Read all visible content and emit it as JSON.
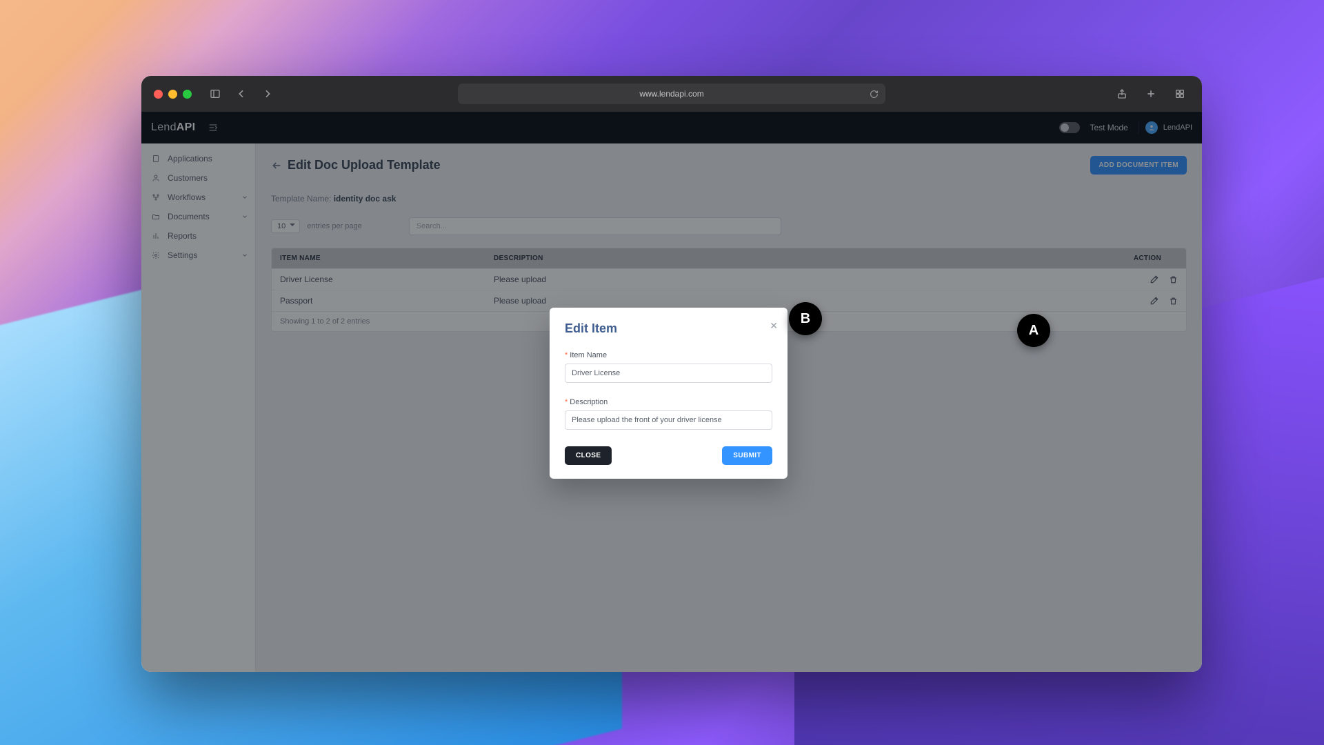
{
  "browser": {
    "url": "www.lendapi.com"
  },
  "app": {
    "logo_prefix": "Lend",
    "logo_suffix": "API",
    "test_mode_label": "Test Mode",
    "user_name": "LendAPI"
  },
  "sidebar": {
    "items": [
      {
        "label": "Applications",
        "icon": "doc",
        "expandable": false
      },
      {
        "label": "Customers",
        "icon": "user",
        "expandable": false
      },
      {
        "label": "Workflows",
        "icon": "flow",
        "expandable": true
      },
      {
        "label": "Documents",
        "icon": "folder",
        "expandable": true
      },
      {
        "label": "Reports",
        "icon": "chart",
        "expandable": false
      },
      {
        "label": "Settings",
        "icon": "gear",
        "expandable": true
      }
    ]
  },
  "page": {
    "title": "Edit Doc Upload Template",
    "add_button": "ADD DOCUMENT ITEM",
    "template_name_label": "Template Name:",
    "template_name_value": "identity doc ask",
    "entries_value": "10",
    "entries_suffix": "entries per page",
    "search_placeholder": "Search...",
    "footer_text": "Showing 1 to 2 of 2 entries"
  },
  "table": {
    "headers": {
      "name": "ITEM NAME",
      "desc": "DESCRIPTION",
      "action": "ACTION"
    },
    "rows": [
      {
        "name": "Driver License",
        "desc": "Please upload"
      },
      {
        "name": "Passport",
        "desc": "Please upload"
      }
    ]
  },
  "modal": {
    "title": "Edit Item",
    "name_label": "Item Name",
    "name_value": "Driver License",
    "desc_label": "Description",
    "desc_value": "Please upload the front of your driver license",
    "close_label": "CLOSE",
    "submit_label": "SUBMIT"
  },
  "markers": {
    "a": "A",
    "b": "B"
  }
}
